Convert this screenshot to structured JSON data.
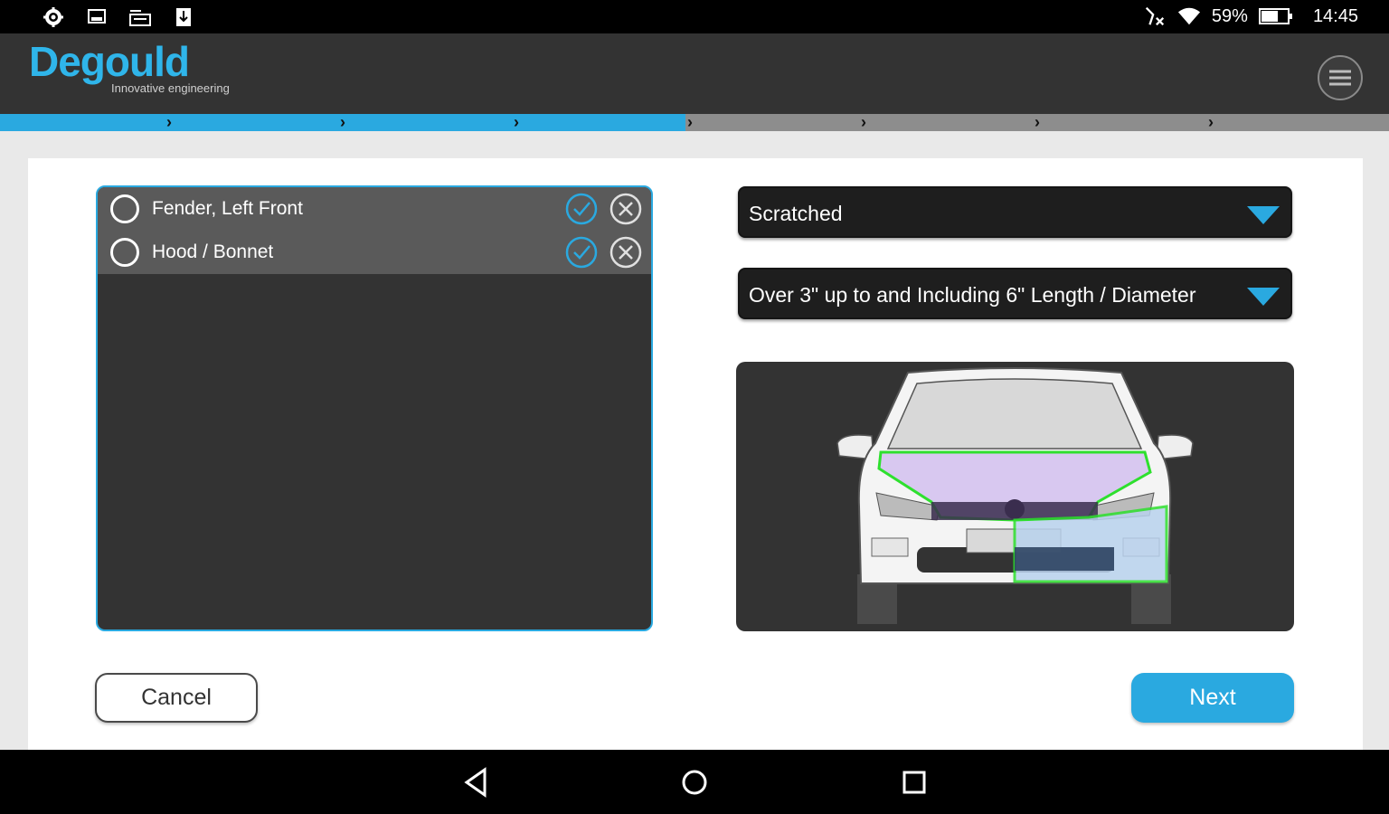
{
  "status_bar": {
    "battery": "59%",
    "time": "14:45",
    "left_icons": [
      "settings-icon",
      "screenshot-icon",
      "card-icon",
      "download-icon"
    ],
    "right_icons": [
      "bluetooth-icon",
      "wifi-icon",
      "battery-icon"
    ]
  },
  "header": {
    "logo": "Degould",
    "tagline": "Innovative engineering",
    "menu_icon": "hamburger-menu-icon"
  },
  "progress": {
    "steps_total": 8,
    "steps_completed": 4,
    "fill_color": "#2aa9e0"
  },
  "damage_list": {
    "items": [
      {
        "label": "Fender, Left Front"
      },
      {
        "label": "Hood / Bonnet"
      }
    ]
  },
  "damage_type": {
    "selected": "Scratched"
  },
  "damage_size": {
    "selected": "Over 3\" up to and Including 6\" Length / Diameter"
  },
  "actions": {
    "cancel": "Cancel",
    "next": "Next"
  },
  "colors": {
    "accent": "#2aa9e0",
    "header_bg": "#333333",
    "highlight_outline": "#2ee02e",
    "highlight_fill": "#d8c8f0"
  }
}
